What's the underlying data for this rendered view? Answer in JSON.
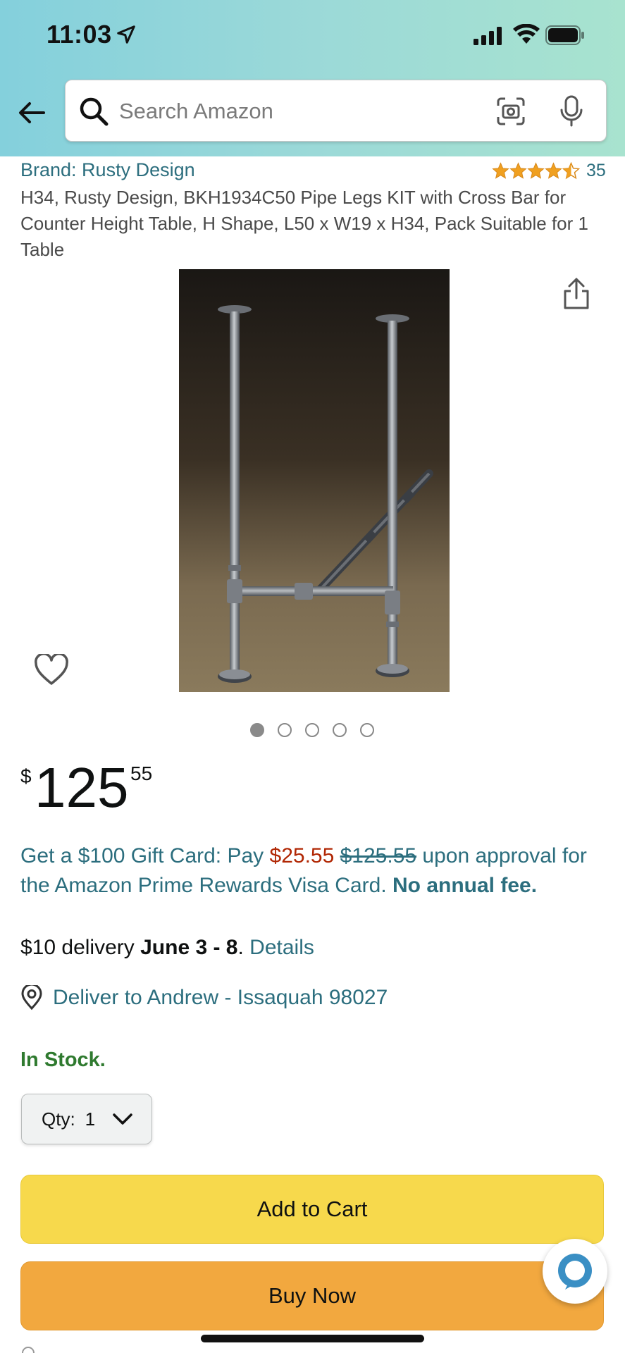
{
  "status_bar": {
    "time": "11:03",
    "icons": [
      "location-arrow-icon",
      "cellular-signal-icon",
      "wifi-icon",
      "battery-icon"
    ]
  },
  "header": {
    "back_icon": "back-arrow-icon",
    "search": {
      "placeholder": "Search Amazon",
      "value": "",
      "icons": [
        "search-icon",
        "camera-scan-icon",
        "microphone-icon"
      ]
    },
    "colors": {
      "gradient_start": "#84d0dc",
      "gradient_end": "#a8e3cf"
    }
  },
  "product": {
    "brand": "Brand: Rusty Design",
    "rating": {
      "stars": 4.5,
      "max_stars": 5,
      "count": "35"
    },
    "title": "H34, Rusty Design, BKH1934C50 Pipe Legs KIT with Cross Bar for Counter Height Table, H Shape, L50 x W19 x H34, Pack Suitable for 1 Table",
    "image_description_icon": "product-photo",
    "image_count": 5,
    "active_image_index": 0,
    "price": {
      "symbol": "$",
      "whole": "125",
      "fraction": "55"
    }
  },
  "promo": {
    "part1": "Get a $100 Gift Card: Pay ",
    "sale_price": "$25.55",
    "space": " ",
    "original_price": "$125.55",
    "part2": " upon approval for the Amazon Prime Rewards Visa Card. ",
    "bold": "No annual fee."
  },
  "delivery": {
    "prefix": "$10 delivery ",
    "dates": "June 3 - 8",
    "separator": ". ",
    "details_link": "Details",
    "deliver_to": "Deliver to Andrew - Issaquah 98027"
  },
  "stock": "In Stock.",
  "quantity": {
    "label": "Qty:",
    "value": "1"
  },
  "buttons": {
    "add_to_cart": "Add to Cart",
    "buy_now": "Buy Now"
  },
  "colors": {
    "link": "#2c6e7e",
    "sale": "#b12704",
    "in_stock": "#2f7a2f",
    "add_to_cart": "#f7d94c",
    "buy_now": "#f2a83f",
    "star": "#f0a020"
  }
}
